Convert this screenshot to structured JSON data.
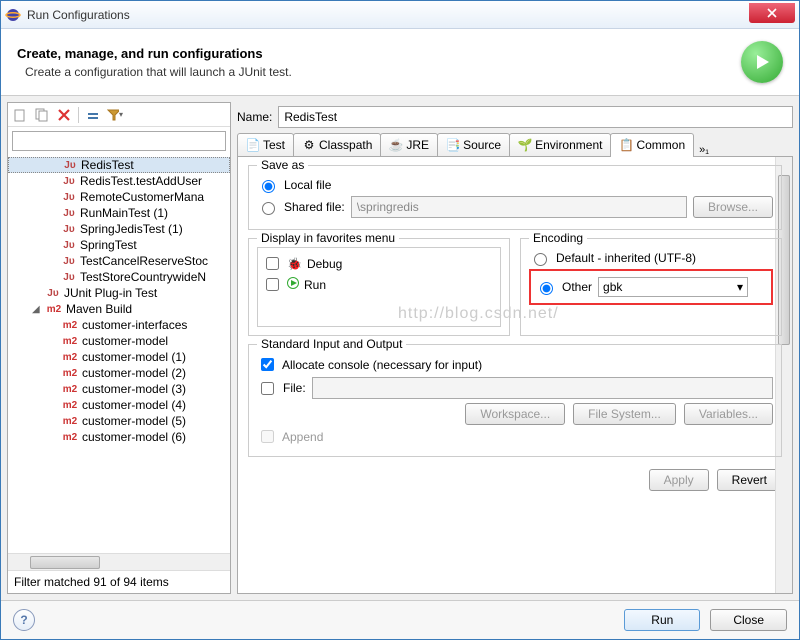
{
  "titlebar": {
    "title": "Run Configurations"
  },
  "header": {
    "title": "Create, manage, and run configurations",
    "subtitle": "Create a configuration that will launch a JUnit test."
  },
  "filter": {
    "value": ""
  },
  "tree": {
    "items": [
      {
        "icon": "ju",
        "label": "RedisTest",
        "level": 2,
        "selected": true
      },
      {
        "icon": "ju",
        "label": "RedisTest.testAddUser",
        "level": 2
      },
      {
        "icon": "ju",
        "label": "RemoteCustomerMana",
        "level": 2
      },
      {
        "icon": "ju",
        "label": "RunMainTest (1)",
        "level": 2
      },
      {
        "icon": "ju",
        "label": "SpringJedisTest (1)",
        "level": 2
      },
      {
        "icon": "ju",
        "label": "SpringTest",
        "level": 2
      },
      {
        "icon": "ju",
        "label": "TestCancelReserveStoc",
        "level": 2
      },
      {
        "icon": "ju",
        "label": "TestStoreCountrywideN",
        "level": 2
      },
      {
        "icon": "ju",
        "label": "JUnit Plug-in Test",
        "level": 1
      },
      {
        "icon": "m2",
        "label": "Maven Build",
        "level": 1,
        "exp": "◢"
      },
      {
        "icon": "m2",
        "label": "customer-interfaces",
        "level": 2
      },
      {
        "icon": "m2",
        "label": "customer-model",
        "level": 2
      },
      {
        "icon": "m2",
        "label": "customer-model (1)",
        "level": 2
      },
      {
        "icon": "m2",
        "label": "customer-model (2)",
        "level": 2
      },
      {
        "icon": "m2",
        "label": "customer-model (3)",
        "level": 2
      },
      {
        "icon": "m2",
        "label": "customer-model (4)",
        "level": 2
      },
      {
        "icon": "m2",
        "label": "customer-model (5)",
        "level": 2
      },
      {
        "icon": "m2",
        "label": "customer-model (6)",
        "level": 2
      }
    ]
  },
  "status": "Filter matched 91 of 94 items",
  "name_label": "Name:",
  "name_value": "RedisTest",
  "tabs": {
    "items": [
      "Test",
      "Classpath",
      "JRE",
      "Source",
      "Environment",
      "Common"
    ],
    "active": 5,
    "more": "»₁"
  },
  "saveas": {
    "title": "Save as",
    "local": "Local file",
    "shared": "Shared file:",
    "shared_value": "\\springredis",
    "browse": "Browse..."
  },
  "favorites": {
    "title": "Display in favorites menu",
    "debug": "Debug",
    "run": "Run"
  },
  "encoding": {
    "title": "Encoding",
    "default": "Default - inherited (UTF-8)",
    "other": "Other",
    "value": "gbk"
  },
  "io": {
    "title": "Standard Input and Output",
    "allocate": "Allocate console (necessary for input)",
    "file": "File:",
    "workspace": "Workspace...",
    "filesystem": "File System...",
    "variables": "Variables...",
    "append": "Append"
  },
  "buttons": {
    "apply": "Apply",
    "revert": "Revert",
    "run": "Run",
    "close": "Close"
  },
  "watermark": "http://blog.csdn.net/"
}
